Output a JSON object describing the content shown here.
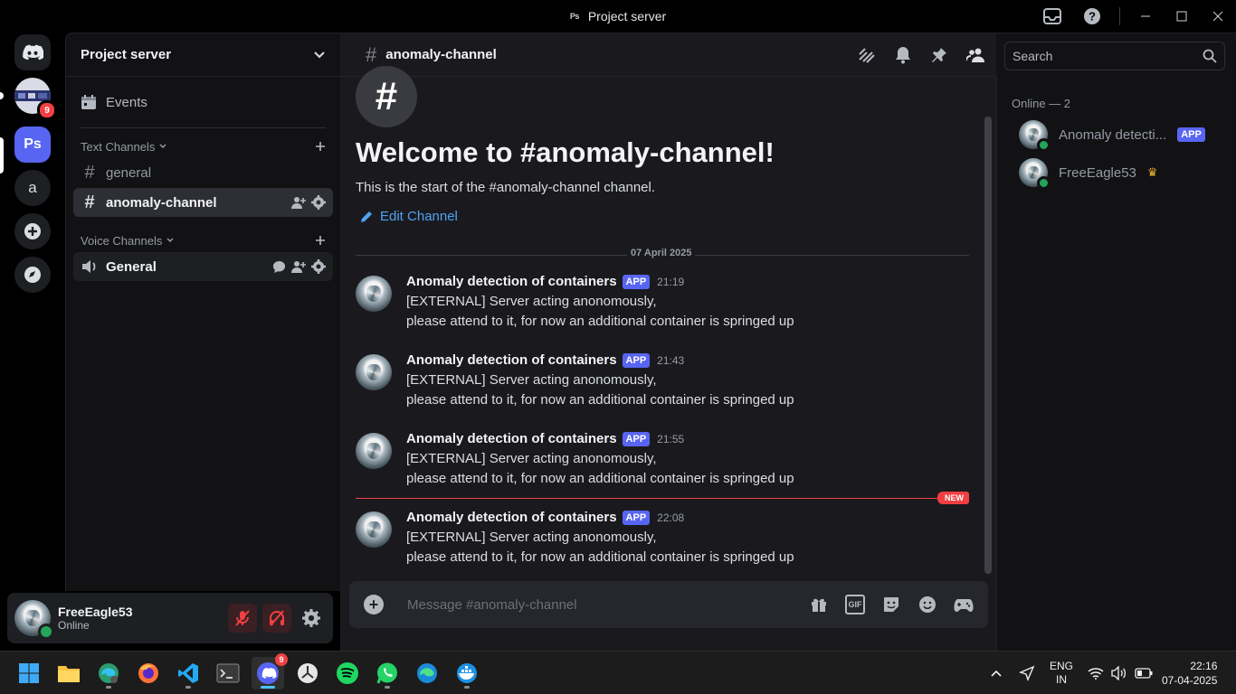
{
  "window": {
    "title": "Project server",
    "app_badge": "Ps"
  },
  "rail": {
    "image_server_badge": "9",
    "ps_label": "Ps",
    "a_label": "a"
  },
  "sidebar": {
    "server_name": "Project server",
    "events_label": "Events",
    "text_category": "Text Channels",
    "voice_category": "Voice Channels",
    "text_channels": [
      {
        "name": "general"
      },
      {
        "name": "anomaly-channel"
      }
    ],
    "voice_channels": [
      {
        "name": "General"
      }
    ]
  },
  "user": {
    "name": "FreeEagle53",
    "status": "Online"
  },
  "chat": {
    "channel": "anomaly-channel",
    "welcome_title": "Welcome to #anomaly-channel!",
    "welcome_sub": "This is the start of the #anomaly-channel channel.",
    "edit_channel": "Edit Channel",
    "date_divider": "07 April 2025",
    "new_label": "NEW",
    "composer_placeholder": "Message #anomaly-channel",
    "messages": [
      {
        "author": "Anomaly detection of containers",
        "tag": "APP",
        "time": "21:19",
        "line1": "[EXTERNAL] Server acting anonomously,",
        "line2": "please attend to it, for now an additional container is springed up"
      },
      {
        "author": "Anomaly detection of containers",
        "tag": "APP",
        "time": "21:43",
        "line1": "[EXTERNAL] Server acting anonomously,",
        "line2": "please attend to it, for now an additional container is springed up"
      },
      {
        "author": "Anomaly detection of containers",
        "tag": "APP",
        "time": "21:55",
        "line1": "[EXTERNAL] Server acting anonomously,",
        "line2": "please attend to it, for now an additional container is springed up"
      },
      {
        "author": "Anomaly detection of containers",
        "tag": "APP",
        "time": "22:08",
        "line1": "[EXTERNAL] Server acting anonomously,",
        "line2": "please attend to it, for now an additional container is springed up"
      }
    ]
  },
  "members": {
    "search_placeholder": "Search",
    "online_header": "Online — 2",
    "list": [
      {
        "name": "Anomaly detecti...",
        "tag": "APP"
      },
      {
        "name": "FreeEagle53"
      }
    ]
  },
  "taskbar": {
    "discord_badge": "9",
    "lang_top": "ENG",
    "lang_bottom": "IN",
    "time": "22:16",
    "date": "07-04-2025"
  },
  "colors": {
    "accent": "#5865f2",
    "danger": "#f23f43",
    "online": "#23a55a",
    "link": "#4fa3f2"
  }
}
